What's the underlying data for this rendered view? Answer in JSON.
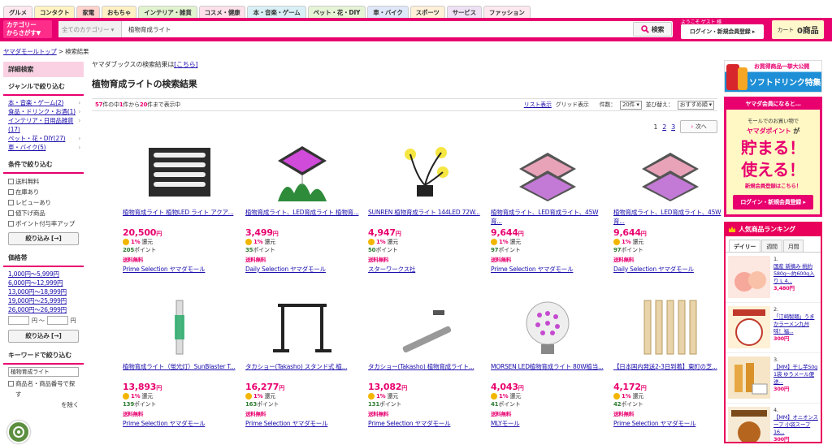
{
  "top_tabs": [
    {
      "label": "グルメ",
      "color": "#fde8ef"
    },
    {
      "label": "コンタクト",
      "color": "#fff3c2"
    },
    {
      "label": "家電",
      "color": "#ffd2cc"
    },
    {
      "label": "おもちゃ",
      "color": "#fff0c4"
    },
    {
      "label": "インテリア・雑貨",
      "color": "#e0f3cf"
    },
    {
      "label": "コスメ・健康",
      "color": "#fde0ea"
    },
    {
      "label": "本・音楽・ゲーム",
      "color": "#d8f0f5"
    },
    {
      "label": "ペット・花・DIY",
      "color": "#e6f4d6"
    },
    {
      "label": "車・バイク",
      "color": "#dfe8f8"
    },
    {
      "label": "スポーツ",
      "color": "#fff0d8"
    },
    {
      "label": "サービス",
      "color": "#efe0f6"
    },
    {
      "label": "ファッション",
      "color": "#fde8ef"
    }
  ],
  "header": {
    "category_button": "カテゴリー\nからさがす▼",
    "search_select": "全てのカテゴリー ▾",
    "search_value": "植物育成ライト",
    "search_button": "検索",
    "welcome": "ようこそ ゲスト 様",
    "login_button": "ログイン・新規会員登録 ▸",
    "cart_label": "カート",
    "cart_count": "0商品"
  },
  "breadcrumb": {
    "home": "ヤマダモールトップ",
    "current": " > 検索結果"
  },
  "sidebar": {
    "detail_search": "詳細検索",
    "genre_title": "ジャンルで絞り込む",
    "genres": [
      {
        "label": "本・音楽・ゲーム(2)"
      },
      {
        "label": "食品・ドリンク・お酒(1)"
      },
      {
        "label": "インテリア・日用品雑貨(17)"
      },
      {
        "label": "ペット・花・DIY(27)"
      },
      {
        "label": "車・バイク(5)"
      }
    ],
    "cond_title": "条件で絞り込む",
    "conditions": [
      "送料無料",
      "在庫あり",
      "レビューあり",
      "値下げ商品",
      "ポイント付与率アップ"
    ],
    "narrow_button": "絞り込み [→]",
    "price_title": "価格帯",
    "prices": [
      "1,000円〜5,999円",
      "6,000円〜12,999円",
      "13,000円〜18,999円",
      "19,000円〜25,999円",
      "26,000円〜26,999円"
    ],
    "price_from_unit": "円 〜",
    "price_to_unit": "円",
    "narrow_button2": "絞り込み [→]",
    "keyword_title": "キーワードで絞り込む",
    "keyword_value": "植物育成ライト",
    "keyword_note": "商品名・商品番号で探す",
    "keyword_note2": "を除く"
  },
  "main": {
    "notice": "ヤマダブックスの検索結果は",
    "notice_link": "[こちら]",
    "title": "植物育成ライトの検索結果",
    "count_total": "57",
    "count_text1": "件の中",
    "count_from": "1",
    "count_text2": "件から",
    "count_to": "20",
    "count_text3": "件まで表示中",
    "view_list": "リスト表示",
    "view_grid": "グリッド表示",
    "per_page_label": "件数：",
    "per_page_value": "20件 ▾",
    "sort_label": "並び替え：",
    "sort_value": "おすすめ順 ▾",
    "pages": [
      "1",
      "2",
      "3"
    ],
    "next": "次へ"
  },
  "products": [
    {
      "name": "植物育成ライト 植物LED ライト アクア...",
      "price": "20,500",
      "yen": "円",
      "rate": "1%",
      "rate_suffix": "還元",
      "points": "205",
      "points_suffix": "ポイント",
      "ship": "送料無料",
      "shop": "Prime Selection ヤマダモール",
      "img": "bars"
    },
    {
      "name": "植物育成ライト、LED育成ライト 植物育...",
      "price": "3,499",
      "yen": "円",
      "rate": "1%",
      "rate_suffix": "還元",
      "points": "35",
      "points_suffix": "ポイント",
      "ship": "送料無料",
      "shop": "Daily Selection ヤマダモール",
      "img": "panel-plant"
    },
    {
      "name": "SUNREN 植物育成ライト 144LED 72W...",
      "price": "4,947",
      "yen": "円",
      "rate": "1%",
      "rate_suffix": "還元",
      "points": "50",
      "points_suffix": "ポイント",
      "ship": "送料無料",
      "shop": "スターワークス社",
      "img": "clip"
    },
    {
      "name": "植物育成ライト、LED育成ライト、45W育...",
      "price": "9,644",
      "yen": "円",
      "rate": "1%",
      "rate_suffix": "還元",
      "points": "97",
      "points_suffix": "ポイント",
      "ship": "送料無料",
      "shop": "Prime Selection ヤマダモール",
      "img": "panels"
    },
    {
      "name": "植物育成ライト、LED育成ライト、45W育...",
      "price": "9,644",
      "yen": "円",
      "rate": "1%",
      "rate_suffix": "還元",
      "points": "97",
      "points_suffix": "ポイント",
      "ship": "送料無料",
      "shop": "Daily Selection ヤマダモール",
      "img": "panels"
    },
    {
      "name": "植物育成ライト（蛍光灯）SunBlaster T...",
      "price": "13,893",
      "yen": "円",
      "rate": "1%",
      "rate_suffix": "還元",
      "points": "139",
      "points_suffix": "ポイント",
      "ship": "送料無料",
      "shop": "Prime Selection ヤマダモール",
      "img": "tube"
    },
    {
      "name": "タカショー(Takasho) スタンド式 植...",
      "price": "16,277",
      "yen": "円",
      "rate": "1%",
      "rate_suffix": "還元",
      "points": "163",
      "points_suffix": "ポイント",
      "ship": "送料無料",
      "shop": "Prime Selection ヤマダモール",
      "img": "stand"
    },
    {
      "name": "タカショー(Takasho) 植物育成ライト...",
      "price": "13,082",
      "yen": "円",
      "rate": "1%",
      "rate_suffix": "還元",
      "points": "131",
      "points_suffix": "ポイント",
      "ship": "送料無料",
      "shop": "Prime Selection ヤマダモール",
      "img": "barlight"
    },
    {
      "name": "MORSEN LED植物育成ライト 80W植当...",
      "price": "4,043",
      "yen": "円",
      "rate": "1%",
      "rate_suffix": "還元",
      "points": "41",
      "points_suffix": "ポイント",
      "ship": "送料無料",
      "shop": "MLYモール",
      "img": "bulb"
    },
    {
      "name": "【日本国内発送2-3日到着】東町の芝...",
      "price": "4,172",
      "yen": "円",
      "rate": "1%",
      "rate_suffix": "還元",
      "points": "42",
      "points_suffix": "ポイント",
      "ship": "送料無料",
      "shop": "Prime Selection ヤマダモール",
      "img": "strips"
    }
  ],
  "right": {
    "ad_top": "お買得商品一挙大公開",
    "ad_title": "ソフトドリンク特集",
    "member_header": "ヤマダ会員になると…",
    "member_line1": "モールでのお買い物で",
    "member_line2": "ヤマダポイント",
    "member_line2b": "が",
    "member_big1": "貯まる！",
    "member_big2": "使える！",
    "member_reg": "新規会員登録はこちら！",
    "member_btn": "ログイン・新規会員登録 ▸",
    "rank_title": "人気商品ランキング",
    "rank_tabs": [
      "デイリー",
      "週間",
      "月間"
    ],
    "rank_items": [
      {
        "no": "1.",
        "name": "国産 新摘み 桃約580g〜約600g入り L 4...",
        "price": "3,480円",
        "img": "peach"
      },
      {
        "no": "2.",
        "name": "「江崎製麺」うまかラーメン九州味！福...",
        "price": "300円",
        "img": "ramen"
      },
      {
        "no": "3.",
        "name": "【MM】干し芋50g 1袋 ゆうメール便 送...",
        "price": "300円",
        "img": "imo"
      },
      {
        "no": "4.",
        "name": "【MM】オニオンスープ 小袋スープ 16...",
        "price": "300円",
        "img": "soup"
      }
    ]
  }
}
